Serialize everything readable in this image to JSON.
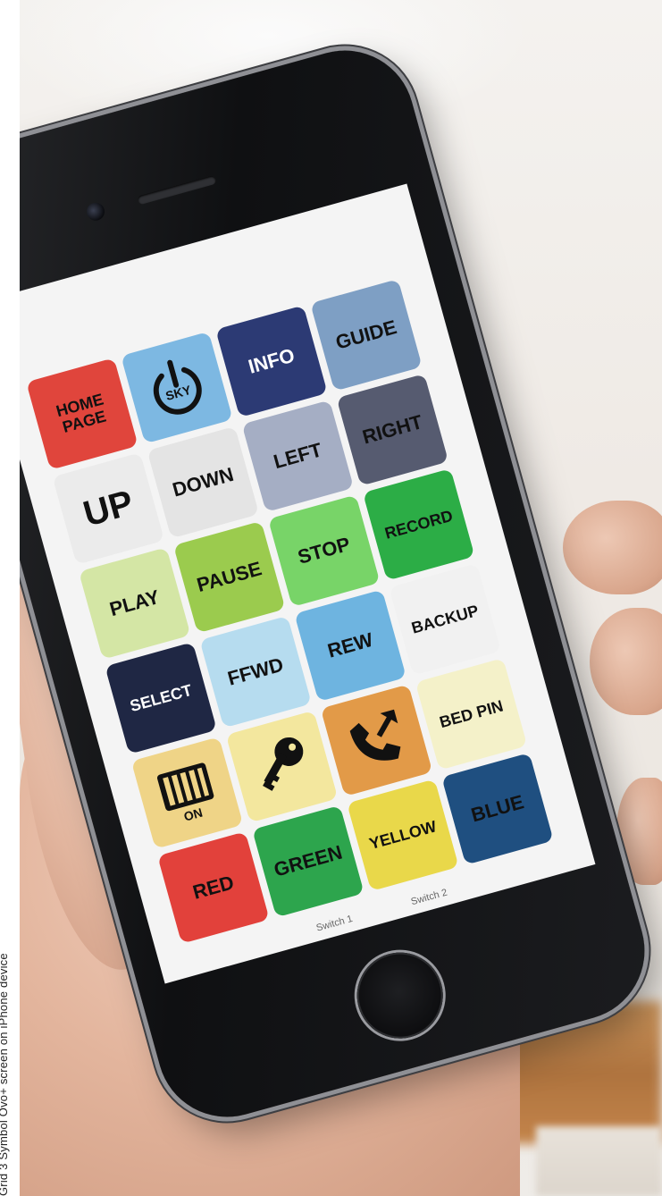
{
  "caption": "Grid 3 Symbol Ovo+ screen on iPhone device",
  "tiles": [
    {
      "label": "HOME PAGE",
      "color": "#e0453c",
      "text_color": "#111111"
    },
    {
      "label": "SKY",
      "color": "#7db8e2",
      "icon": "power-icon"
    },
    {
      "label": "INFO",
      "color": "#2c3a74",
      "text_color": "#ffffff"
    },
    {
      "label": "GUIDE",
      "color": "#7e9fc4",
      "text_color": "#111111"
    },
    {
      "label": "UP",
      "color": "#ebebeb",
      "text_color": "#111111"
    },
    {
      "label": "DOWN",
      "color": "#e4e4e4",
      "text_color": "#111111"
    },
    {
      "label": "LEFT",
      "color": "#a5aec4",
      "text_color": "#111111"
    },
    {
      "label": "RIGHT",
      "color": "#565b70",
      "text_color": "#111111"
    },
    {
      "label": "PLAY",
      "color": "#d4e6a5",
      "text_color": "#111111"
    },
    {
      "label": "PAUSE",
      "color": "#9bcb4e",
      "text_color": "#111111"
    },
    {
      "label": "STOP",
      "color": "#78d468",
      "text_color": "#111111"
    },
    {
      "label": "RECORD",
      "color": "#2cad46",
      "text_color": "#111111"
    },
    {
      "label": "SELECT",
      "color": "#1f2744",
      "text_color": "#ffffff"
    },
    {
      "label": "FFWD",
      "color": "#b6dcef",
      "text_color": "#111111"
    },
    {
      "label": "REW",
      "color": "#6eb4e0",
      "text_color": "#111111"
    },
    {
      "label": "BACKUP",
      "color": "#f1f1f1",
      "text_color": "#111111"
    },
    {
      "label": "ON",
      "color": "#efd487",
      "icon": "heater-icon"
    },
    {
      "label": "",
      "color": "#f3e79e",
      "icon": "key-icon"
    },
    {
      "label": "",
      "color": "#e29a48",
      "icon": "phone-call-icon"
    },
    {
      "label": "BED PIN",
      "color": "#f4f1c9",
      "text_color": "#111111"
    },
    {
      "label": "RED",
      "color": "#e2413b",
      "text_color": "#111111"
    },
    {
      "label": "GREEN",
      "color": "#2da54d",
      "text_color": "#111111"
    },
    {
      "label": "YELLOW",
      "color": "#e9d84a",
      "text_color": "#111111"
    },
    {
      "label": "BLUE",
      "color": "#1f4f80",
      "text_color": "#111111"
    }
  ],
  "switch_labels": [
    "Switch 1",
    "Switch 2"
  ]
}
